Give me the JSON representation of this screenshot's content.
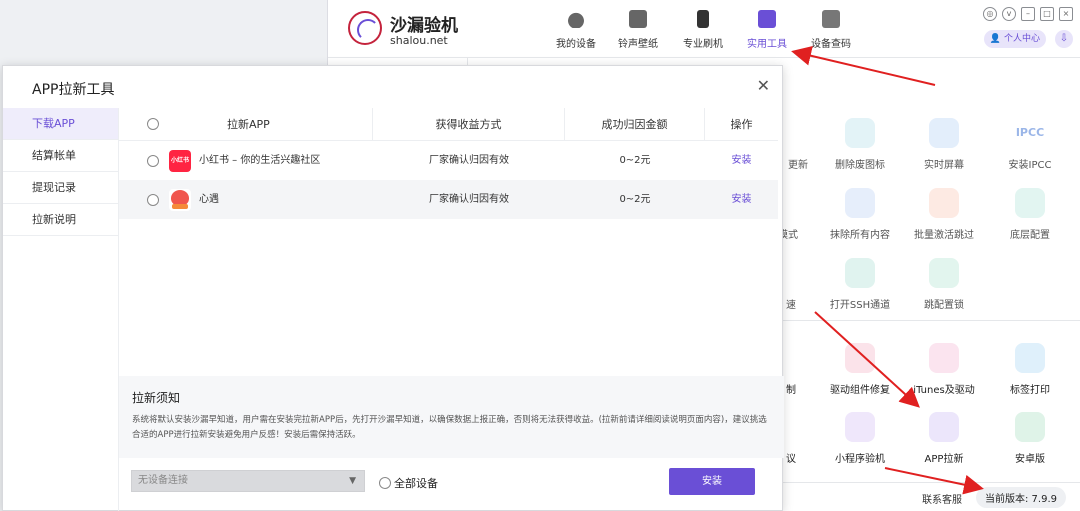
{
  "app": {
    "name": "沙漏验机",
    "domain": "shalou.net",
    "user_center": "个人中心",
    "nav": [
      "我的设备",
      "铃声壁纸",
      "专业刷机",
      "实用工具",
      "设备查码"
    ],
    "active_nav": "实用工具",
    "tools": [
      {
        "label": "更新",
        "icon": "update-icon"
      },
      {
        "label": "删除废图标",
        "icon": "trash-icon"
      },
      {
        "label": "实时屏幕",
        "icon": "phone-screen-icon"
      },
      {
        "label": "安装IPCC",
        "icon": "ipcc-icon",
        "icon_text": "IPCC"
      },
      {
        "label": "模式",
        "icon": "mode-icon"
      },
      {
        "label": "抹除所有内容",
        "icon": "broom-icon"
      },
      {
        "label": "批量激活跳过",
        "icon": "skip-icon"
      },
      {
        "label": "底层配置",
        "icon": "config-icon"
      },
      {
        "label": "速",
        "icon": "speed-icon"
      },
      {
        "label": "打开SSH通道",
        "icon": "terminal-icon"
      },
      {
        "label": "跳配置锁",
        "icon": "lock-reset-icon"
      },
      {
        "label": "制",
        "icon": "make-icon"
      },
      {
        "label": "驱动组件修复",
        "icon": "wrench-icon"
      },
      {
        "label": "iTunes及驱动",
        "icon": "music-icon"
      },
      {
        "label": "标签打印",
        "icon": "printer-icon"
      },
      {
        "label": "议",
        "icon": "protocol-icon"
      },
      {
        "label": "小程序验机",
        "icon": "miniprogram-icon"
      },
      {
        "label": "APP拉新",
        "icon": "paper-plane-icon"
      },
      {
        "label": "安卓版",
        "icon": "android-icon"
      }
    ],
    "footer": {
      "contact": "联系客服",
      "version": "当前版本: 7.9.9"
    }
  },
  "dialog": {
    "title": "APP拉新工具",
    "sidebar": [
      "下载APP",
      "结算帐单",
      "提现记录",
      "拉新说明"
    ],
    "active_sidebar": "下载APP",
    "columns": [
      "拉新APP",
      "获得收益方式",
      "成功归因金额",
      "操作"
    ],
    "rows": [
      {
        "app": "小红书 – 你的生活兴趣社区",
        "icon_text": "小红书",
        "method": "厂家确认归因有效",
        "amount": "0~2元",
        "action": "安装"
      },
      {
        "app": "心遇",
        "method": "厂家确认归因有效",
        "amount": "0~2元",
        "action": "安装"
      }
    ],
    "notice_title": "拉新须知",
    "notice_body": "系统将默认安装沙漏早知道，用户需在安装完拉新APP后，先打开沙漏早知道，以确保数据上报正确，否则将无法获得收益。(拉新前请详细阅读说明页面内容)，建议挑选合适的APP进行拉新安装避免用户反感！安装后需保持活跃。",
    "device_placeholder": "无设备连接",
    "all_devices": "全部设备",
    "install_button": "安装"
  }
}
